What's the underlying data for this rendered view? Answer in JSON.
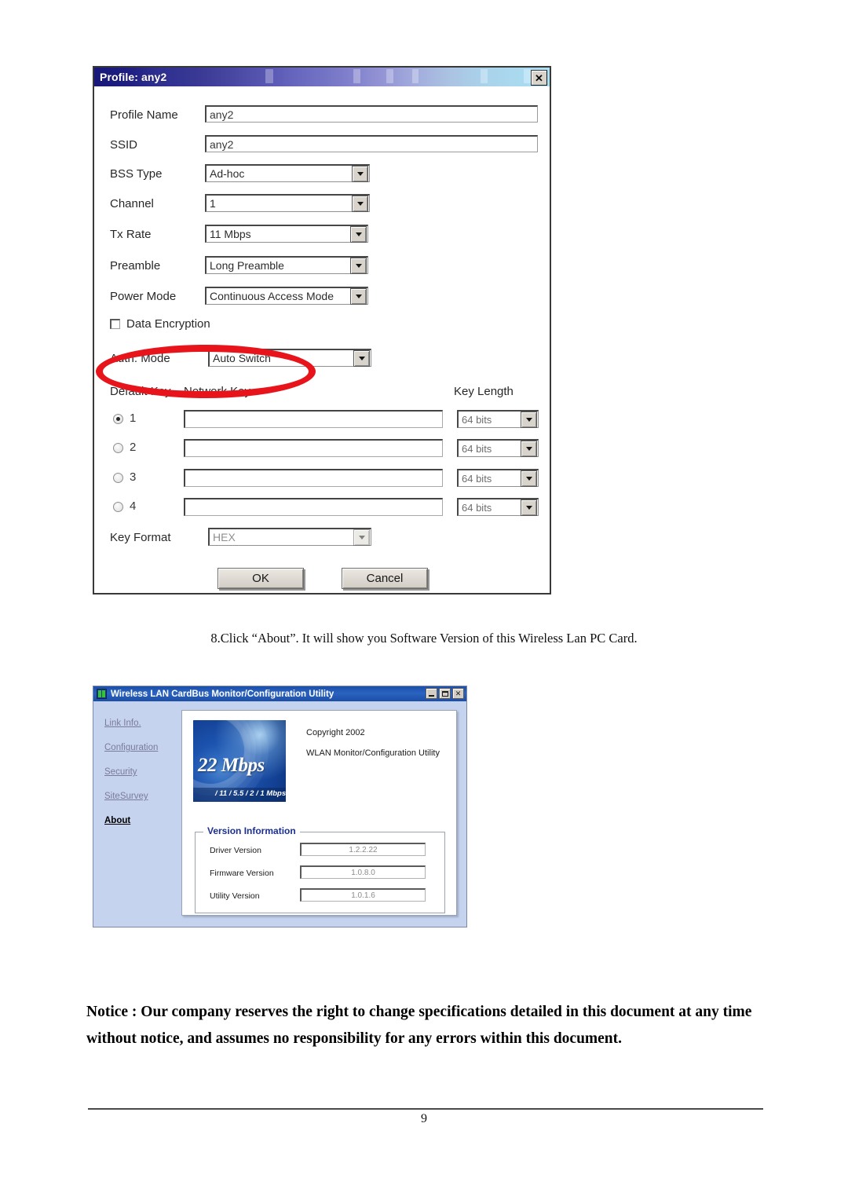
{
  "profile_dialog": {
    "title": "Profile: any2",
    "close_label": "✕",
    "fields": [
      {
        "label": "Profile Name",
        "value": "any2",
        "type": "text"
      },
      {
        "label": "SSID",
        "value": "any2",
        "type": "text"
      },
      {
        "label": "BSS Type",
        "value": "Ad-hoc",
        "type": "combo"
      },
      {
        "label": "Channel",
        "value": "1",
        "type": "combo"
      },
      {
        "label": "Tx Rate",
        "value": "11 Mbps",
        "type": "combo"
      },
      {
        "label": "Preamble",
        "value": "Long Preamble",
        "type": "combo"
      },
      {
        "label": "Power Mode",
        "value": "Continuous Access Mode",
        "type": "combo"
      }
    ],
    "data_encryption": {
      "label": "Data Encryption",
      "checked": false
    },
    "auth_mode": {
      "label": "Auth. Mode",
      "value": "Auto Switch"
    },
    "column_headers": {
      "default_key": "Default Key",
      "network_key": "Network Key",
      "key_length": "Key Length"
    },
    "keys": [
      {
        "index": "1",
        "selected": true,
        "network_key": "",
        "key_length": "64 bits"
      },
      {
        "index": "2",
        "selected": false,
        "network_key": "",
        "key_length": "64 bits"
      },
      {
        "index": "3",
        "selected": false,
        "network_key": "",
        "key_length": "64 bits"
      },
      {
        "index": "4",
        "selected": false,
        "network_key": "",
        "key_length": "64 bits"
      }
    ],
    "key_format": {
      "label": "Key Format",
      "value": "HEX"
    },
    "buttons": {
      "ok": "OK",
      "cancel": "Cancel"
    },
    "annotation_color": "#e8141b"
  },
  "caption": "8.Click “About”. It will show you Software Version of this Wireless Lan PC Card.",
  "about_window": {
    "title": "Wireless LAN CardBus Monitor/Configuration Utility",
    "window_buttons": {
      "minimize": "_",
      "maximize": "□",
      "close": "✕"
    },
    "nav_items": [
      {
        "label": "Link Info.",
        "active": false
      },
      {
        "label": "Configuration",
        "active": false
      },
      {
        "label": "Security",
        "active": false
      },
      {
        "label": "SiteSurvey",
        "active": false
      },
      {
        "label": "About",
        "active": true
      }
    ],
    "logo": {
      "main": "22 Mbps",
      "sub": "/ 11 / 5.5 / 2 / 1 Mbps"
    },
    "copyright": "Copyright 2002",
    "product_line": "WLAN Monitor/Configuration Utility",
    "version_information": {
      "legend": "Version Information",
      "rows": [
        {
          "label": "Driver Version",
          "value": "1.2.2.22"
        },
        {
          "label": "Firmware Version",
          "value": "1.0.8.0"
        },
        {
          "label": "Utility Version",
          "value": "1.0.1.6"
        }
      ]
    }
  },
  "notice": {
    "line1": "Notice : Our company reserves the right to change specifications detailed in this document at any time",
    "line2": "without notice, and assumes no responsibility for any errors within this document."
  },
  "footer": {
    "page_number": "9"
  }
}
